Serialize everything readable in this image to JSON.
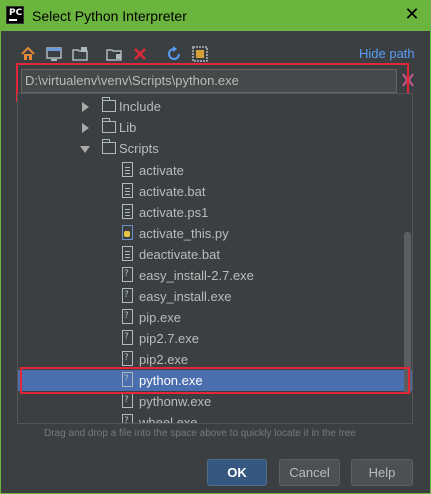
{
  "window": {
    "title": "Select Python Interpreter",
    "app_icon_text": "PC"
  },
  "toolbar": {
    "buttons": [
      "home-icon",
      "desktop-icon",
      "project-folder-icon",
      "new-folder-icon",
      "delete-icon",
      "refresh-icon",
      "show-hidden-icon"
    ],
    "hide_path_label": "Hide path"
  },
  "path_field": {
    "value": "D:\\virtualenv\\venv\\Scripts\\python.exe"
  },
  "tree": {
    "folders": [
      {
        "label": "Include",
        "expanded": false
      },
      {
        "label": "Lib",
        "expanded": false
      },
      {
        "label": "Scripts",
        "expanded": true
      }
    ],
    "files": [
      {
        "label": "activate",
        "icon": "text-file-icon"
      },
      {
        "label": "activate.bat",
        "icon": "text-file-icon"
      },
      {
        "label": "activate.ps1",
        "icon": "text-file-icon"
      },
      {
        "label": "activate_this.py",
        "icon": "python-file-icon"
      },
      {
        "label": "deactivate.bat",
        "icon": "text-file-icon"
      },
      {
        "label": "easy_install-2.7.exe",
        "icon": "unknown-file-icon"
      },
      {
        "label": "easy_install.exe",
        "icon": "unknown-file-icon"
      },
      {
        "label": "pip.exe",
        "icon": "unknown-file-icon"
      },
      {
        "label": "pip2.7.exe",
        "icon": "unknown-file-icon"
      },
      {
        "label": "pip2.exe",
        "icon": "unknown-file-icon"
      },
      {
        "label": "python.exe",
        "icon": "unknown-file-icon",
        "selected": true
      },
      {
        "label": "pythonw.exe",
        "icon": "unknown-file-icon"
      },
      {
        "label": "wheel.exe",
        "icon": "unknown-file-icon"
      }
    ]
  },
  "hint_text": "Drag and drop a file into the space above to quickly locate it in the tree",
  "buttons": {
    "ok": "OK",
    "cancel": "Cancel",
    "help": "Help"
  },
  "colors": {
    "title_bar": "#6bb53f",
    "background": "#3c3f41",
    "selection": "#4b6eaf",
    "highlight_border": "#e0283a",
    "link": "#589df6"
  }
}
